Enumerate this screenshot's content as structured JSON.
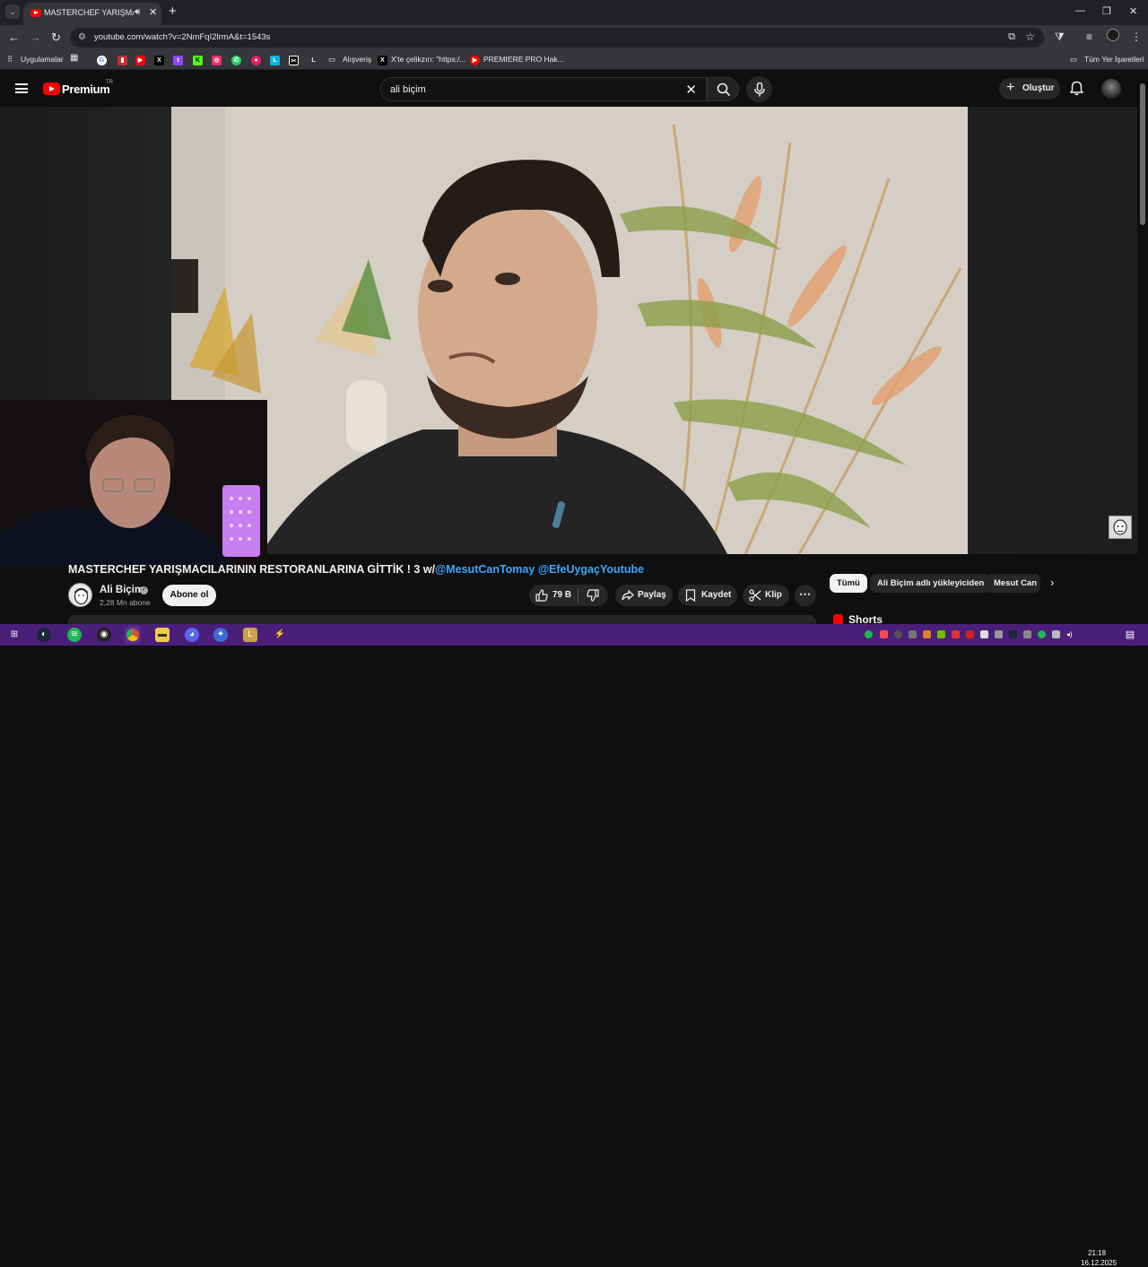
{
  "browser": {
    "tab_title": "MASTERCHEF YARIŞMACILARIN",
    "url": "youtube.com/watch?v=2NmFqI2lrmA&t=1543s",
    "bookmarks": {
      "apps": "Uygulamalar",
      "shopping": "Alışveriş",
      "x_tweet": "X'te çelikzırı: \"https:/...",
      "premiere": "PREMIERE PRO Hak...",
      "all_bookmarks": "Tüm Yer İşaretleri"
    }
  },
  "youtube": {
    "logo_text": "Premium",
    "country_code": "TR",
    "search_value": "ali biçim",
    "create_label": "Oluştur",
    "video": {
      "title": "MASTERCHEF YARIŞMACILARININ RESTORANLARINA GİTTİK ! 3 w/",
      "tag1": "@MesutCanTomay",
      "tag2": "@EfeUygaçYoutube"
    },
    "channel": {
      "name": "Ali Biçim",
      "subscribers": "2,28 Mn abone",
      "subscribe_label": "Abone ol"
    },
    "actions": {
      "likes": "79 B",
      "share": "Paylaş",
      "save": "Kaydet",
      "clip": "Klip"
    },
    "chips": [
      "Tümü",
      "Ali Biçim adlı yükleyiciden",
      "Mesut Can"
    ],
    "shorts_label": "Shorts"
  },
  "taskbar": {
    "time": "21:18",
    "date": "16.12.2025"
  },
  "colors": {
    "accent_blue": "#3ea6ff",
    "youtube_red": "#ff0000",
    "taskbar": "#4a1f7a"
  }
}
